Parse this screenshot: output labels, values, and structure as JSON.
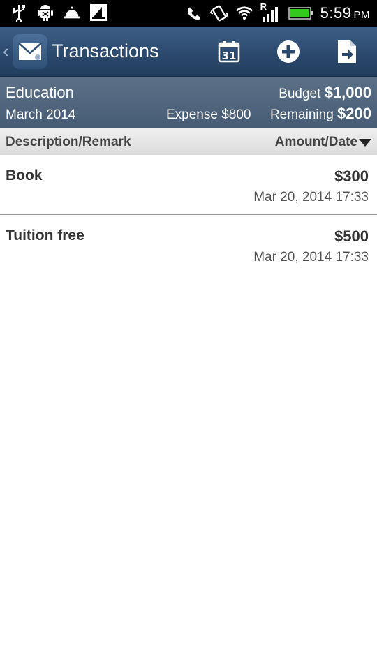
{
  "status_bar": {
    "time": "5:59",
    "ampm": "PM",
    "signal_badge": "R",
    "left_icons": [
      "usb-icon",
      "android-debug-icon",
      "bell-icon",
      "sailboat-icon"
    ],
    "right_icons": [
      "phone-icon",
      "vibrate-icon",
      "wifi-icon",
      "signal-icon",
      "battery-icon"
    ]
  },
  "action_bar": {
    "title": "Transactions",
    "buttons": [
      "calendar-icon",
      "add-icon",
      "export-icon"
    ]
  },
  "summary": {
    "category": "Education",
    "month": "March 2014",
    "budget_label": "Budget",
    "budget_value": "$1,000",
    "expense_label": "Expense",
    "expense_value": "$800",
    "remaining_label": "Remaining",
    "remaining_value": "$200"
  },
  "columns": {
    "left": "Description/Remark",
    "right": "Amount/Date"
  },
  "transactions": [
    {
      "description": "Book",
      "amount": "$300",
      "date": "Mar 20, 2014 17:33"
    },
    {
      "description": "Tuition free",
      "amount": "$500",
      "date": "Mar 20, 2014 17:33"
    }
  ],
  "colors": {
    "action_bar": "#2c4a6e",
    "summary_band": "#52687f",
    "column_header": "#e4e4e4",
    "battery": "#35c81e"
  }
}
